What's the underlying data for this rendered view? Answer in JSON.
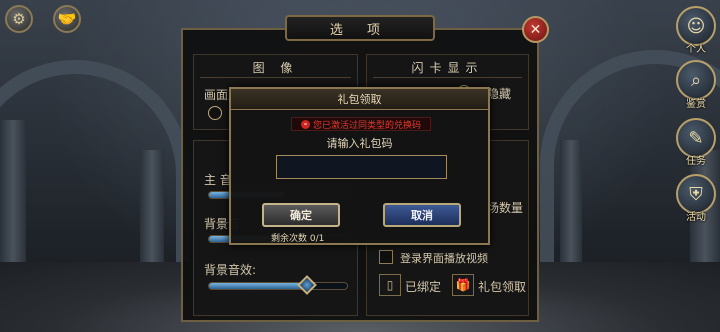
{
  "options": {
    "title": "选 项",
    "graphics": {
      "title": "图 像",
      "quality_label": "画面质量"
    },
    "flash": {
      "title": "闪卡显示",
      "option_hide_all": "部隐藏"
    },
    "audio": {
      "main_volume_label": "主 音",
      "bg_label_partial": "背景音",
      "bg_sfx_label": "背景音效:",
      "bg_sfx_level": 0.72
    },
    "other": {
      "scene_count_partial": "场数量",
      "login_video_label": "登录界面播放视频",
      "bound_label": "已绑定",
      "gift_label": "礼包领取"
    }
  },
  "gift_dialog": {
    "title": "礼包领取",
    "warning": "您已激活过同类型的兑换码",
    "prompt": "请输入礼包码",
    "input_value": "",
    "confirm_label": "确定",
    "cancel_label": "取消",
    "remaining": "剩余次数 0/1"
  },
  "side_menu": [
    {
      "label": "个人",
      "icon": "head-icon"
    },
    {
      "label": "鉴赏",
      "icon": "magnifier-icon"
    },
    {
      "label": "任务",
      "icon": "scroll-icon"
    },
    {
      "label": "活动",
      "icon": "armor-icon"
    }
  ],
  "colors": {
    "accent_gold": "#8b7750",
    "warning_red": "#e03b2f",
    "cancel_blue": "#2d4a86"
  }
}
